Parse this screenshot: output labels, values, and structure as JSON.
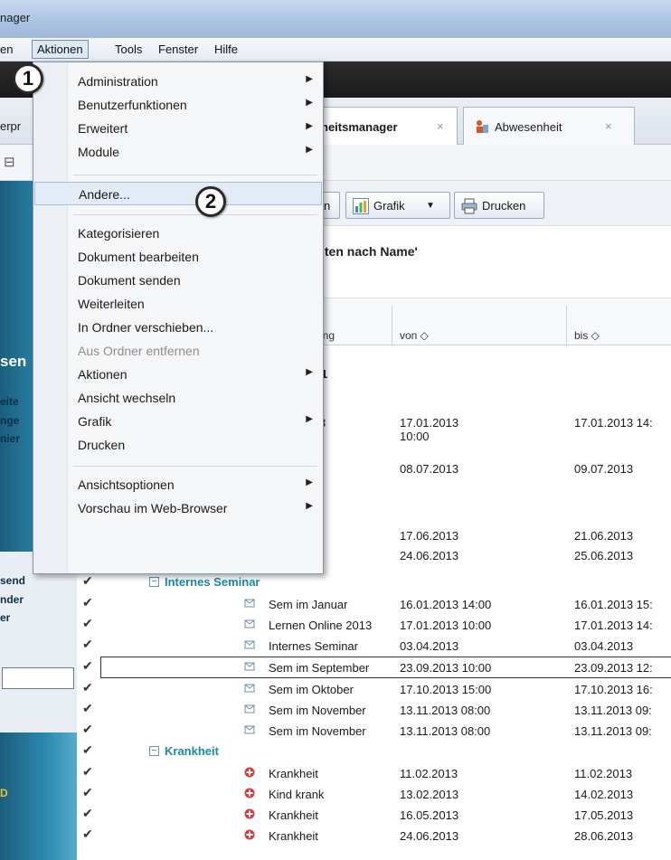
{
  "window": {
    "title": "nager"
  },
  "menubar": {
    "items": [
      {
        "id": "en",
        "label": "en"
      },
      {
        "id": "aktionen",
        "label": "Aktionen"
      },
      {
        "id": "tools",
        "label": "Tools"
      },
      {
        "id": "fenster",
        "label": "Fenster"
      },
      {
        "id": "hilfe",
        "label": "Hilfe"
      }
    ]
  },
  "tabs": {
    "left_fragment": "erpr",
    "active": {
      "label": "heitsmanager",
      "close": "×"
    },
    "second": {
      "label": "Abwesenheit",
      "close": "×"
    }
  },
  "smallbar": {
    "icon_glyph": "⊟"
  },
  "toolbar": {
    "btn_n": "n",
    "grafik": "Grafik",
    "grafik_arrow": "▼",
    "drucken": "Drucken"
  },
  "view": {
    "heading": "iten nach Name'",
    "columns": {
      "c1": "ung",
      "von": "von ◇",
      "bis": "bis ◇"
    },
    "year_fragment": "1"
  },
  "sidebar": {
    "labels": [
      "eite",
      "nge",
      "nier",
      "sen",
      "send",
      "nder",
      "er",
      "D"
    ]
  },
  "partial_rows": [
    {
      "c1": "3",
      "von": "17.01.2013 10:00",
      "bis": "17.01.2013 14:"
    },
    {
      "c1": "",
      "von": "08.07.2013",
      "bis": "09.07.2013"
    },
    {
      "c1": "",
      "von": "17.06.2013",
      "bis": "21.06.2013"
    },
    {
      "c1": "",
      "von": "24.06.2013",
      "bis": "25.06.2013"
    }
  ],
  "groups": {
    "seminar": "Internes Seminar",
    "krankheit": "Krankheit"
  },
  "rows": [
    {
      "name": "Sem im Januar",
      "von": "16.01.2013 14:00",
      "bis": "16.01.2013 15:",
      "type": "seminar"
    },
    {
      "name": "Lernen Online 2013",
      "von": "17.01.2013 10:00",
      "bis": "17.01.2013 14:",
      "type": "seminar"
    },
    {
      "name": "Internes Seminar",
      "von": "03.04.2013",
      "bis": "03.04.2013",
      "type": "seminar"
    },
    {
      "name": "Sem im September",
      "von": "23.09.2013 10:00",
      "bis": "23.09.2013 12:",
      "type": "seminar"
    },
    {
      "name": "Sem im Oktober",
      "von": "17.10.2013 15:00",
      "bis": "17.10.2013 16:",
      "type": "seminar"
    },
    {
      "name": "Sem im November",
      "von": "13.11.2013 08:00",
      "bis": "13.11.2013 09:",
      "type": "seminar"
    },
    {
      "name": "Sem im November",
      "von": "13.11.2013 08:00",
      "bis": "13.11.2013 09:",
      "type": "seminar"
    },
    {
      "name": "Krankheit",
      "von": "11.02.2013",
      "bis": "11.02.2013",
      "type": "krank"
    },
    {
      "name": "Kind krank",
      "von": "13.02.2013",
      "bis": "14.02.2013",
      "type": "krank"
    },
    {
      "name": "Krankheit",
      "von": "16.05.2013",
      "bis": "17.05.2013",
      "type": "krank"
    },
    {
      "name": "Krankheit",
      "von": "24.06.2013",
      "bis": "28.06.2013",
      "type": "krank"
    }
  ],
  "check_glyph": "✔",
  "context_menu": {
    "items": [
      {
        "label": "Administration",
        "submenu": true
      },
      {
        "label": "Benutzerfunktionen",
        "submenu": true
      },
      {
        "label": "Erweitert",
        "submenu": true
      },
      {
        "label": "Module",
        "submenu": true
      },
      {
        "label": "Andere...",
        "submenu": false,
        "hover": true
      },
      {
        "label": "Kategorisieren",
        "submenu": false
      },
      {
        "label": "Dokument bearbeiten",
        "submenu": false
      },
      {
        "label": "Dokument senden",
        "submenu": false
      },
      {
        "label": "Weiterleiten",
        "submenu": false
      },
      {
        "label": "In Ordner verschieben...",
        "submenu": false
      },
      {
        "label": "Aus Ordner entfernen",
        "submenu": false,
        "disabled": true
      },
      {
        "label": "Aktionen",
        "submenu": true
      },
      {
        "label": "Ansicht wechseln",
        "submenu": false
      },
      {
        "label": "Grafik",
        "submenu": true
      },
      {
        "label": "Drucken",
        "submenu": false
      },
      {
        "label": "Ansichtsoptionen",
        "submenu": true
      },
      {
        "label": "Vorschau im Web-Browser",
        "submenu": true
      }
    ],
    "arrow_glyph": "▶"
  },
  "badges": {
    "one": "1",
    "two": "2"
  },
  "colors": {
    "accent": "#1a8aa0",
    "menu_hover": "#e2ebf6",
    "sidebar": "#2c8ab0"
  }
}
